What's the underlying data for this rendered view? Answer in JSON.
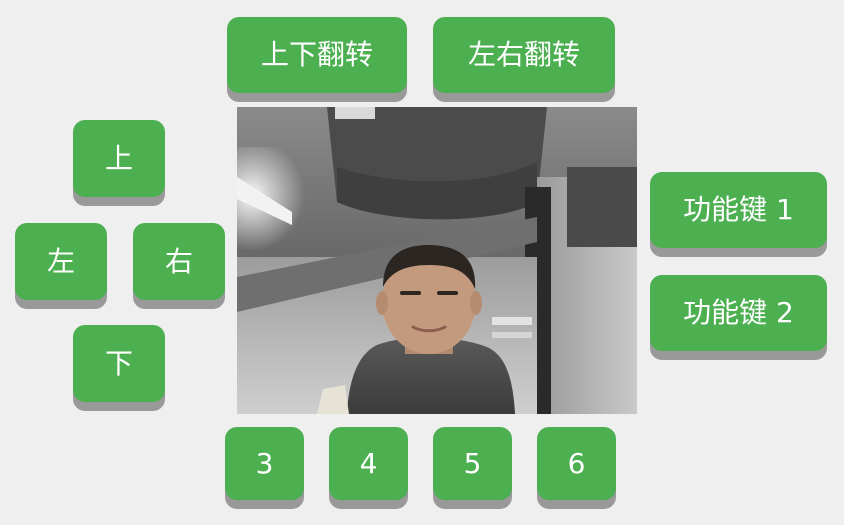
{
  "controls": {
    "flip_vertical_label": "上下翻转",
    "flip_horizontal_label": "左右翻转",
    "up_label": "上",
    "left_label": "左",
    "right_label": "右",
    "down_label": "下",
    "function_key_1_label": "功能键 1",
    "function_key_2_label": "功能键 2",
    "key_3_label": "3",
    "key_4_label": "4",
    "key_5_label": "5",
    "key_6_label": "6"
  },
  "colors": {
    "button": "#4caf50",
    "button_shadow": "#999999",
    "button_text": "#ffffff",
    "background": "#efefef"
  }
}
